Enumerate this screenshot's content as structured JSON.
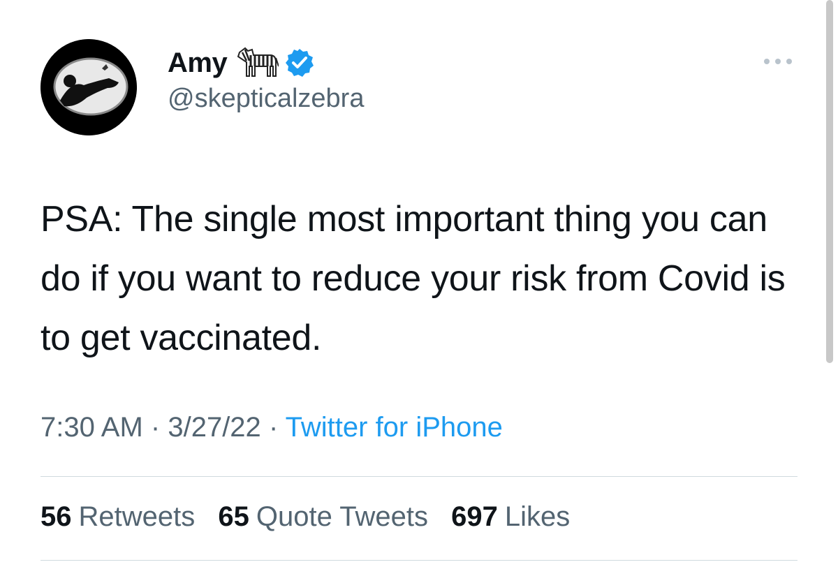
{
  "author": {
    "display_name": "Amy",
    "name_emoji": "zebra-emoji",
    "verified_icon": "verified-badge-icon",
    "handle": "@skepticalzebra",
    "avatar": "profile-avatar"
  },
  "more_icon": "more-options-icon",
  "tweet": {
    "text": "PSA: The single most important thing you can do if you want to reduce your risk from Covid is to get vaccinated."
  },
  "meta": {
    "time": "7:30 AM",
    "separator": "·",
    "date": "3/27/22",
    "source": "Twitter for iPhone"
  },
  "stats": {
    "retweets": {
      "count": "56",
      "label": "Retweets"
    },
    "quote_tweets": {
      "count": "65",
      "label": "Quote Tweets"
    },
    "likes": {
      "count": "697",
      "label": "Likes"
    }
  },
  "colors": {
    "text": "#0f1419",
    "secondary": "#536471",
    "accent": "#1d9bf0",
    "divider": "#cfd9de"
  }
}
